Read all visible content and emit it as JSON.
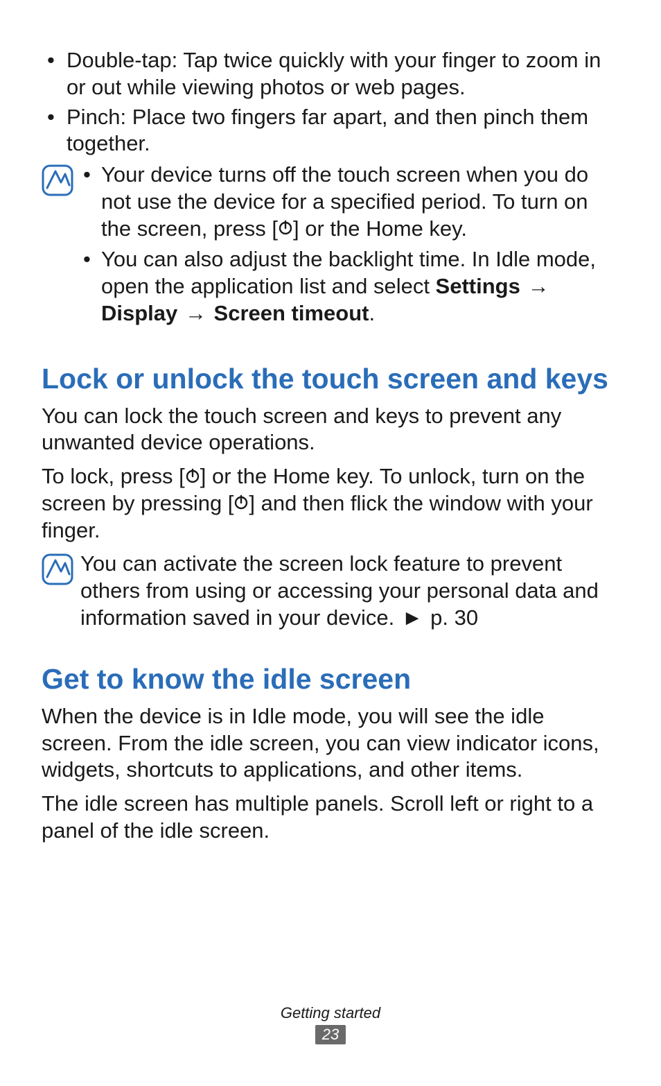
{
  "bullets": {
    "double_tap": "Double-tap: Tap twice quickly with your finger to zoom in or out while viewing photos or web pages.",
    "pinch": "Pinch: Place two fingers far apart, and then pinch them together."
  },
  "note1": {
    "item1_a": "Your device turns off the touch screen when you do not use the device for a specified period. To turn on the screen, press [",
    "item1_b": "] or the Home key.",
    "item2_a": "You can also adjust the backlight time. In Idle mode, open the application list and select ",
    "settings": "Settings",
    "display": "Display",
    "timeout": "Screen timeout",
    "period": "."
  },
  "section_lock": {
    "heading": "Lock or unlock the touch screen and keys",
    "p1": "You can lock the touch screen and keys to prevent any unwanted device operations.",
    "p2_a": "To lock, press [",
    "p2_b": "] or the Home key. To unlock, turn on the screen by pressing [",
    "p2_c": "] and then flick the window with your finger."
  },
  "note2": {
    "text_a": "You can activate the screen lock feature to prevent others from using or accessing your personal data and information saved in your device. ",
    "ref": "p. 30"
  },
  "section_idle": {
    "heading": "Get to know the idle screen",
    "p1": "When the device is in Idle mode, you will see the idle screen. From the idle screen, you can view indicator icons, widgets, shortcuts to applications, and other items.",
    "p2": "The idle screen has multiple panels. Scroll left or right to a panel of the idle screen."
  },
  "footer": {
    "section": "Getting started",
    "page": "23"
  },
  "glyphs": {
    "arrow": "→",
    "triangle": "►"
  }
}
